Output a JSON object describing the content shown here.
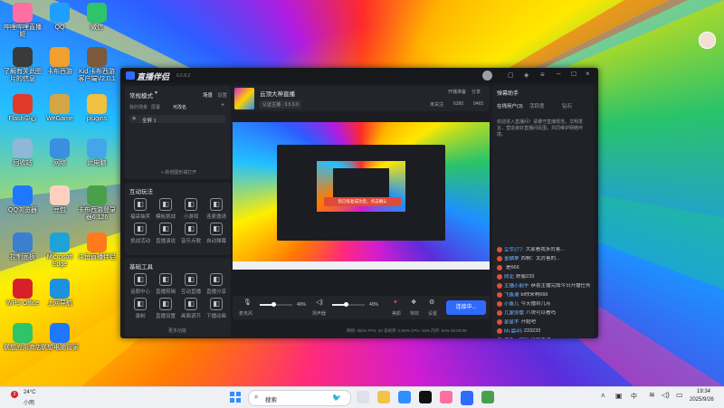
{
  "desktop_icons": [
    {
      "label": "哔哩哔哩直播姬",
      "icon": "bilibili-live-icon",
      "color": "#ff6fa0"
    },
    {
      "label": "QQ",
      "icon": "qq-icon",
      "color": "#1e9fff"
    },
    {
      "label": "微信",
      "icon": "wechat-icon",
      "color": "#2ec56a"
    },
    {
      "label": "了解有关此图片的信息",
      "icon": "info-camera-icon",
      "color": "#3a3a3a"
    },
    {
      "label": "卡布西游",
      "icon": "kabu-game-icon",
      "color": "#f0a030"
    },
    {
      "label": "Kid 卡布西游 客户端V2.0.1",
      "icon": "kabu-client-icon",
      "color": "#7a5a3a"
    },
    {
      "label": "Flash中心",
      "icon": "flash-center-icon",
      "color": "#e0392a"
    },
    {
      "label": "WeGame",
      "icon": "wegame-icon",
      "color": "#d4a545"
    },
    {
      "label": "plugins",
      "icon": "folder-icon",
      "color": "#f0c040"
    },
    {
      "label": "回收站",
      "icon": "recycle-bin-icon",
      "color": "#8fb8d8"
    },
    {
      "label": "网络",
      "icon": "network-icon",
      "color": "#3a8fe0"
    },
    {
      "label": "此电脑",
      "icon": "this-pc-icon",
      "color": "#44a6e8"
    },
    {
      "label": "QQ浏览器",
      "icon": "qq-browser-icon",
      "color": "#1e78ff"
    },
    {
      "label": "豆包",
      "icon": "doubao-icon",
      "color": "#ffd0c0"
    },
    {
      "label": "卡布西游登录器6.126",
      "icon": "kabu-login-icon",
      "color": "#4aa04a"
    },
    {
      "label": "控制面板",
      "icon": "control-panel-icon",
      "color": "#3a7fd0"
    },
    {
      "label": "Microsoft Edge",
      "icon": "edge-icon",
      "color": "#1fa2d8"
    },
    {
      "label": "斗鱼直播伴侣",
      "icon": "douyu-icon",
      "color": "#ff7a1a"
    },
    {
      "label": "WPS Office",
      "icon": "wps-icon",
      "color": "#d8202a"
    },
    {
      "label": "上网导航",
      "icon": "nav-e-icon",
      "color": "#1e90e0"
    },
    {
      "label": "联想应用商店",
      "icon": "lenovo-store-icon",
      "color": "#2ec56a"
    },
    {
      "label": "联想电脑管家",
      "icon": "lenovo-manager-icon",
      "color": "#1e78ff"
    }
  ],
  "app": {
    "name": "直播伴侣",
    "version": "6.5.8.2",
    "mode_label": "常规模式",
    "tab_scene": "场景",
    "tab_settings": "设置",
    "source_tabs": [
      "我的场景",
      "屏幕",
      "可改名"
    ],
    "scene_item": "全屏 1",
    "add_source_label": "+ 新增图形或打开",
    "interactive_title": "互动玩法",
    "interactive_tools": [
      "福袋抽奖",
      "模板挑战",
      "小游戏",
      "连麦邀请",
      "挑战活动",
      "直播演说",
      "音乐点歌",
      "自动弹幕"
    ],
    "basic_title": "基础工具",
    "basic_tools": [
      "话题中心",
      "直播剪辑",
      "互动直播",
      "直播分享",
      "录制",
      "直播设置",
      "画面调节",
      "下播动画"
    ],
    "more_label": "更多功能",
    "stream_title": "云顶大神直播",
    "tag_label": "认证主播 · 3.5.9.0",
    "status_bar_buttons": [
      "开播准备",
      "分享"
    ],
    "stats": {
      "likes": "6280",
      "viewers": "9465",
      "follow_label": "未关注"
    },
    "preview_toast": "您已恢复成功后，点击确认",
    "audio": {
      "mic_label": "麦克风",
      "mic_value": "40%",
      "speaker_label": "扬声器",
      "speaker_value": "40%"
    },
    "controls": [
      "美颜",
      "特效",
      "设置"
    ],
    "go_live_button": "连接中...",
    "status_bar": "网络: 0kb/s  FPS: 30  丢帧率: 0.00%  CPU: 32%  内存: 54%  00:00:00"
  },
  "chat": {
    "title": "弹幕助手",
    "tabs": [
      "在线用户(3)",
      "活跃度",
      "钻石"
    ],
    "notice": "欢迎进入直播间！请遵守直播规范，文明发言，营造良好直播间氛围，共同维护网络环境。",
    "messages": [
      {
        "name": "尘华277:",
        "text": "大家看我多厉害..."
      },
      {
        "name": "金鳞草",
        "text": "西桐：太厉害的..."
      },
      {
        "name": "",
        "text": "是666"
      },
      {
        "name": "阿北",
        "text": "舒服233"
      },
      {
        "name": "主播小助手",
        "text": "恭喜主播完成今日开播任务，获得2000热度"
      },
      {
        "name": "飞鱼潮",
        "text": "bi你来啊666"
      },
      {
        "name": "小鱼儿",
        "text": "今天播到几点"
      },
      {
        "name": "几家你像",
        "text": "八块可以看吗"
      },
      {
        "name": "星星不",
        "text": "开始吧"
      },
      {
        "name": "Mr.晨4S",
        "text": "233233"
      },
      {
        "name": "老鱼一定服",
        "text": "以后再说"
      },
      {
        "name": "戒原",
        "text": "来啦"
      },
      {
        "name": "豆浆馒头",
        "text": "来啦"
      },
      {
        "name": "小小波",
        "text": "来啦"
      },
      {
        "name": "罗伊和",
        "text": "来啦"
      }
    ]
  },
  "taskbar": {
    "weather_temp": "24°C",
    "weather_desc": "小雨",
    "search_placeholder": "搜索",
    "notification_count": "2",
    "time": "19:34",
    "date": "2025/9/26"
  },
  "colors": {
    "accent": "#2f6bff",
    "live_button": "#2f6bff",
    "toast": "#e04a3a",
    "app_bg": "#1c1d22"
  }
}
